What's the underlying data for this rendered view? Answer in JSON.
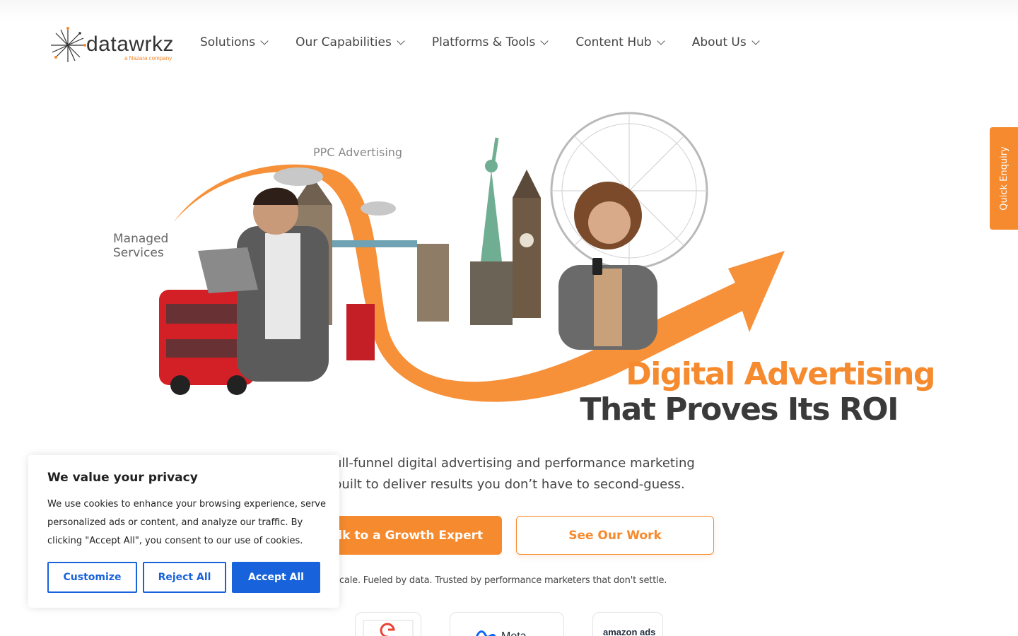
{
  "brand": {
    "name": "datawrkz",
    "tagline": "a Nazara company",
    "accent": "#f58a2e"
  },
  "nav": [
    {
      "label": "Solutions"
    },
    {
      "label": "Our Capabilities"
    },
    {
      "label": "Platforms & Tools"
    },
    {
      "label": "Content Hub"
    },
    {
      "label": "About Us"
    }
  ],
  "hero": {
    "labels": {
      "ppc": "PPC Advertising",
      "managed": "Managed Services"
    },
    "headline_line1": "Digital Advertising",
    "headline_line2": "That Proves Its ROI",
    "subtext": "ull-funnel digital advertising and performance marketing built to deliver results you don’t have to second-guess.",
    "cta_primary": "alk to a Growth Expert",
    "cta_secondary": "See Our Work",
    "tagline": "lt for scale. Fueled by data. Trusted by performance marketers that don't settle."
  },
  "partners": [
    {
      "name": "G",
      "icon": "google-logo"
    },
    {
      "name": "Meta",
      "icon": "meta-logo"
    },
    {
      "name": "amazon ads",
      "icon": "amazon-ads-logo"
    }
  ],
  "quick_enquiry": {
    "label": "Quick Enquiry"
  },
  "cookie": {
    "title": "We value your privacy",
    "body": "We use cookies to enhance your browsing experience, serve personalized ads or content, and analyze our traffic. By clicking \"Accept All\", you consent to our use of cookies.",
    "customize": "Customize",
    "reject": "Reject All",
    "accept": "Accept All",
    "button_color": "#1863dc"
  }
}
